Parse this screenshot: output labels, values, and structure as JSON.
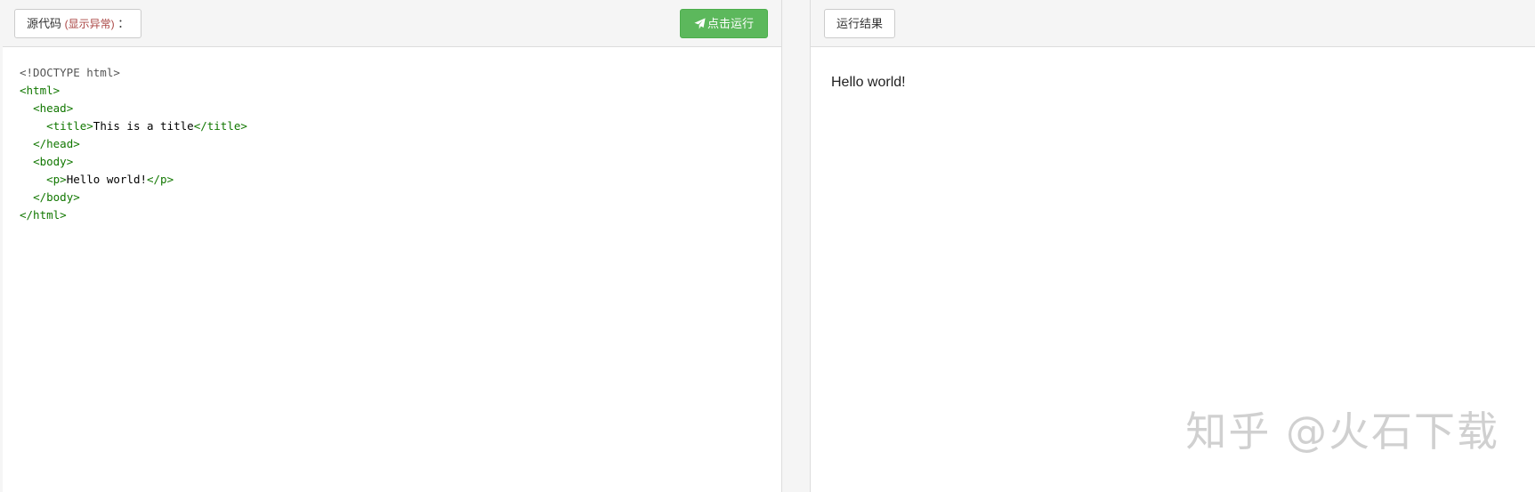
{
  "editor": {
    "source_label": "源代码",
    "source_note": "(显示异常)",
    "source_colon": "：",
    "run_label": "点击运行",
    "run_icon": "paper-plane-icon",
    "code_lines": [
      [
        {
          "t": "doctype",
          "v": "<!DOCTYPE html>"
        }
      ],
      [
        {
          "t": "tag",
          "v": "<html>"
        }
      ],
      [
        {
          "t": "text",
          "v": "  "
        },
        {
          "t": "tag",
          "v": "<head>"
        }
      ],
      [
        {
          "t": "text",
          "v": "    "
        },
        {
          "t": "tag",
          "v": "<title>"
        },
        {
          "t": "text",
          "v": "This is a title"
        },
        {
          "t": "tag",
          "v": "</title>"
        }
      ],
      [
        {
          "t": "text",
          "v": "  "
        },
        {
          "t": "tag",
          "v": "</head>"
        }
      ],
      [
        {
          "t": "text",
          "v": "  "
        },
        {
          "t": "tag",
          "v": "<body>"
        }
      ],
      [
        {
          "t": "text",
          "v": "    "
        },
        {
          "t": "tag",
          "v": "<p>"
        },
        {
          "t": "text",
          "v": "Hello world!"
        },
        {
          "t": "tag",
          "v": "</p>"
        }
      ],
      [
        {
          "t": "text",
          "v": "  "
        },
        {
          "t": "tag",
          "v": "</body>"
        }
      ],
      [
        {
          "t": "tag",
          "v": "</html>"
        }
      ]
    ]
  },
  "result": {
    "label": "运行结果",
    "output_text": "Hello world!"
  },
  "watermark": "知乎 @火石下载",
  "colors": {
    "run_button": "#5cb85c",
    "code_tag": "#117700",
    "note": "#a94442"
  }
}
